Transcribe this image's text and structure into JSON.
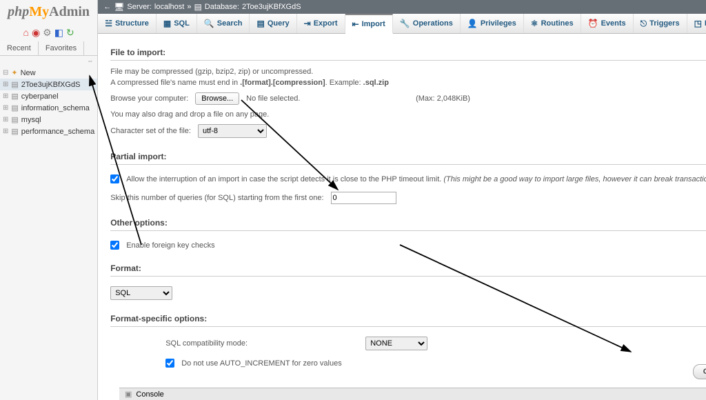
{
  "logo": {
    "php": "php",
    "my": "My",
    "admin": "Admin"
  },
  "sidebar": {
    "nav": {
      "recent": "Recent",
      "favorites": "Favorites"
    },
    "new_label": "New",
    "items": [
      {
        "label": "2Toe3ujKBfXGdS"
      },
      {
        "label": "cyberpanel"
      },
      {
        "label": "information_schema"
      },
      {
        "label": "mysql"
      },
      {
        "label": "performance_schema"
      }
    ]
  },
  "breadcrumb": {
    "server_label": "Server:",
    "server": "localhost",
    "db_label": "Database:",
    "db": "2Toe3ujKBfXGdS"
  },
  "tabs": [
    {
      "label": "Structure"
    },
    {
      "label": "SQL"
    },
    {
      "label": "Search"
    },
    {
      "label": "Query"
    },
    {
      "label": "Export"
    },
    {
      "label": "Import"
    },
    {
      "label": "Operations"
    },
    {
      "label": "Privileges"
    },
    {
      "label": "Routines"
    },
    {
      "label": "Events"
    },
    {
      "label": "Triggers"
    },
    {
      "label": "Designer"
    }
  ],
  "sections": {
    "file_to_import": "File to import:",
    "compress_note": "File may be compressed (gzip, bzip2, zip) or uncompressed.",
    "filename_note_prefix": "A compressed file's name must end in ",
    "filename_note_bold": ".[format].[compression]",
    "filename_note_mid": ". Example: ",
    "filename_note_example": ".sql.zip",
    "browse_label": "Browse your computer:",
    "browse_button": "Browse...",
    "no_file": "No file selected.",
    "max_label": "(Max: 2,048KiB)",
    "drag_note": "You may also drag and drop a file on any page.",
    "charset_label": "Character set of the file:",
    "charset_value": "utf-8",
    "partial_import": "Partial import:",
    "allow_interrupt": "Allow the interruption of an import in case the script detects it is close to the PHP timeout limit. ",
    "allow_interrupt_hint": "(This might be a good way to import large files, however it can break transactions.)",
    "skip_queries_label": "Skip this number of queries (for SQL) starting from the first one:",
    "skip_value": 0,
    "other_options": "Other options:",
    "enable_fk": "Enable foreign key checks",
    "format": "Format:",
    "format_value": "SQL",
    "format_specific": "Format-specific options:",
    "compat_label": "SQL compatibility mode:",
    "compat_value": "NONE",
    "no_autoinc": "Do not use AUTO_INCREMENT for zero values",
    "go": "Go"
  },
  "console": {
    "label": "Console"
  }
}
